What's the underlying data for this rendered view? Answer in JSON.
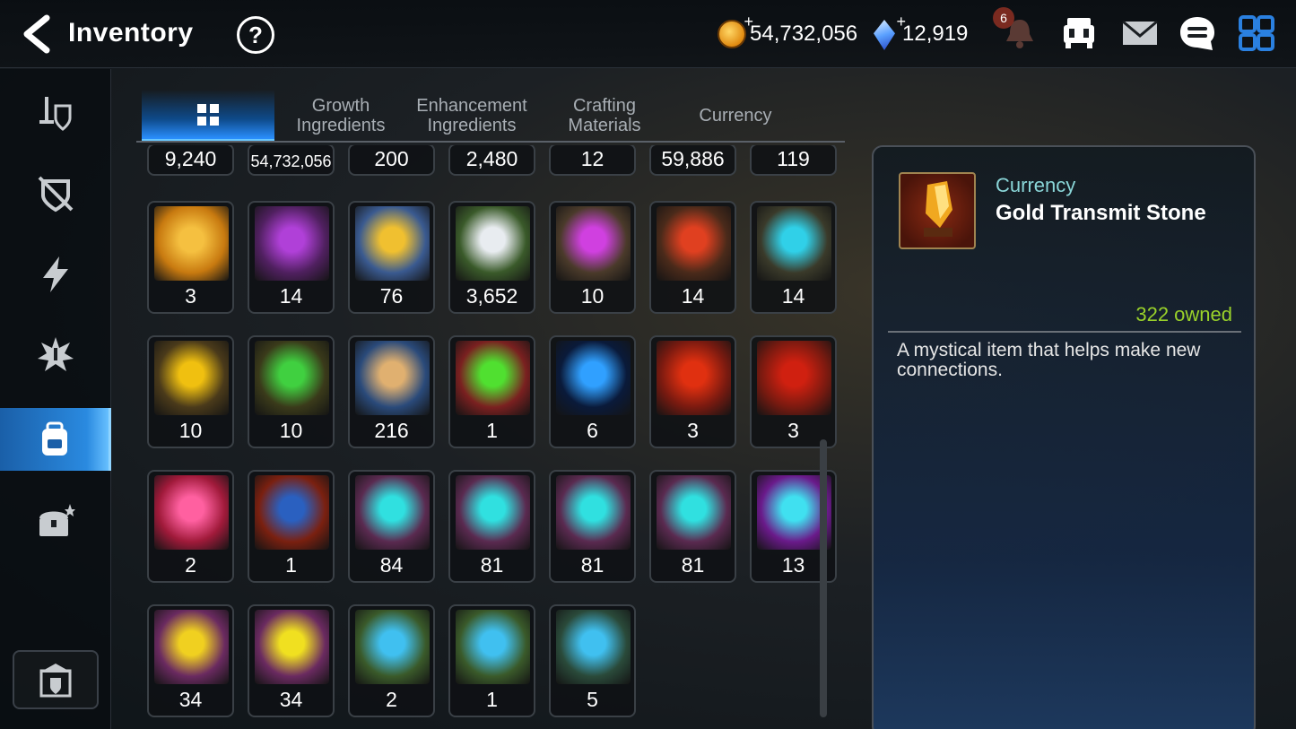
{
  "header": {
    "title": "Inventory",
    "help_symbol": "?",
    "gold_amount": "54,732,056",
    "crystal_amount": "12,919",
    "notification_count": "6"
  },
  "tabs": [
    {
      "label": "",
      "icon": "grid-icon",
      "active": true
    },
    {
      "label": "Growth\nIngredients"
    },
    {
      "label": "Enhancement\nIngredients"
    },
    {
      "label": "Crafting\nMaterials"
    },
    {
      "label": "Currency"
    }
  ],
  "partial_row": [
    "9,240",
    "54,732,056",
    "200",
    "2,480",
    "12",
    "59,886",
    "119"
  ],
  "items": [
    {
      "qty": "3",
      "icon": "chick-avatar"
    },
    {
      "qty": "14",
      "icon": "purple-flower"
    },
    {
      "qty": "76",
      "icon": "gold-flower"
    },
    {
      "qty": "3,652",
      "icon": "silver-flower"
    },
    {
      "qty": "10",
      "icon": "purple-rune"
    },
    {
      "qty": "14",
      "icon": "red-rune"
    },
    {
      "qty": "14",
      "icon": "cyan-rune"
    },
    {
      "qty": "10",
      "icon": "yellow-rune"
    },
    {
      "qty": "10",
      "icon": "green-rune"
    },
    {
      "qty": "216",
      "icon": "ginseng-root"
    },
    {
      "qty": "1",
      "icon": "green-orb"
    },
    {
      "qty": "6",
      "icon": "blue-circuit-disc"
    },
    {
      "qty": "3",
      "icon": "red-hammer-stone"
    },
    {
      "qty": "3",
      "icon": "red-bolt-stone"
    },
    {
      "qty": "2",
      "icon": "pink-potion"
    },
    {
      "qty": "1",
      "icon": "blue-orb-stone"
    },
    {
      "qty": "84",
      "icon": "cyan-sword-stone"
    },
    {
      "qty": "81",
      "icon": "cyan-helmet-stone"
    },
    {
      "qty": "81",
      "icon": "cyan-armor-stone"
    },
    {
      "qty": "81",
      "icon": "cyan-boot-stone"
    },
    {
      "qty": "13",
      "icon": "purple-star-stone"
    },
    {
      "qty": "34",
      "icon": "gold-hammer-stone"
    },
    {
      "qty": "34",
      "icon": "gold-bolt-stone"
    },
    {
      "qty": "2",
      "icon": "white-sword-stone"
    },
    {
      "qty": "1",
      "icon": "white-boot-stone"
    },
    {
      "qty": "5",
      "icon": "white-star-stone"
    }
  ],
  "detail": {
    "category": "Currency",
    "name": "Gold Transmit Stone",
    "owned": "322 owned",
    "description": "A mystical item that helps make new connections."
  }
}
